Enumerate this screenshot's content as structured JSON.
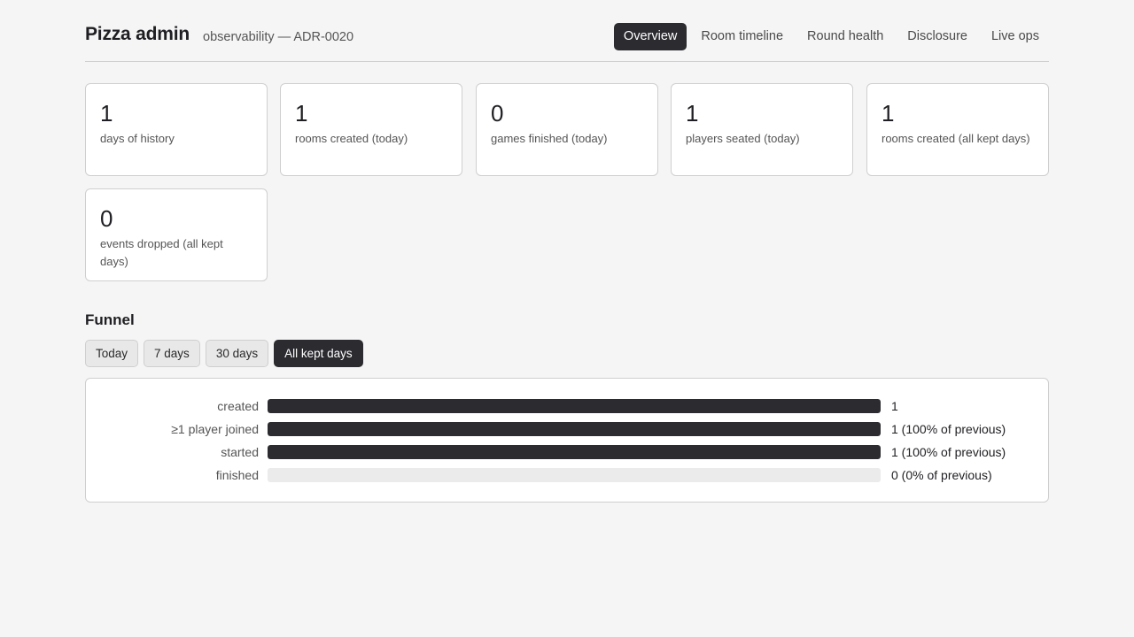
{
  "header": {
    "title": "Pizza admin",
    "subtitle": "observability — ADR-0020",
    "tabs": [
      {
        "label": "Overview",
        "active": true
      },
      {
        "label": "Room timeline",
        "active": false
      },
      {
        "label": "Round health",
        "active": false
      },
      {
        "label": "Disclosure",
        "active": false
      },
      {
        "label": "Live ops",
        "active": false
      }
    ]
  },
  "stats": [
    {
      "value": "1",
      "label": "days of history"
    },
    {
      "value": "1",
      "label": "rooms created (today)"
    },
    {
      "value": "0",
      "label": "games finished (today)"
    },
    {
      "value": "1",
      "label": "players seated (today)"
    },
    {
      "value": "1",
      "label": "rooms created (all kept days)"
    },
    {
      "value": "0",
      "label": "events dropped (all kept days)"
    }
  ],
  "funnel": {
    "title": "Funnel",
    "ranges": [
      {
        "label": "Today",
        "active": false
      },
      {
        "label": "7 days",
        "active": false
      },
      {
        "label": "30 days",
        "active": false
      },
      {
        "label": "All kept days",
        "active": true
      }
    ],
    "rows": [
      {
        "label": "created",
        "count": "1",
        "fraction": 1.0
      },
      {
        "label": "≥1 player joined",
        "count": "1 (100% of previous)",
        "fraction": 1.0
      },
      {
        "label": "started",
        "count": "1 (100% of previous)",
        "fraction": 1.0
      },
      {
        "label": "finished",
        "count": "0 (0% of previous)",
        "fraction": 0.0
      }
    ],
    "colors": {
      "bar": "#2b2b30",
      "track": "#ebebec"
    }
  }
}
